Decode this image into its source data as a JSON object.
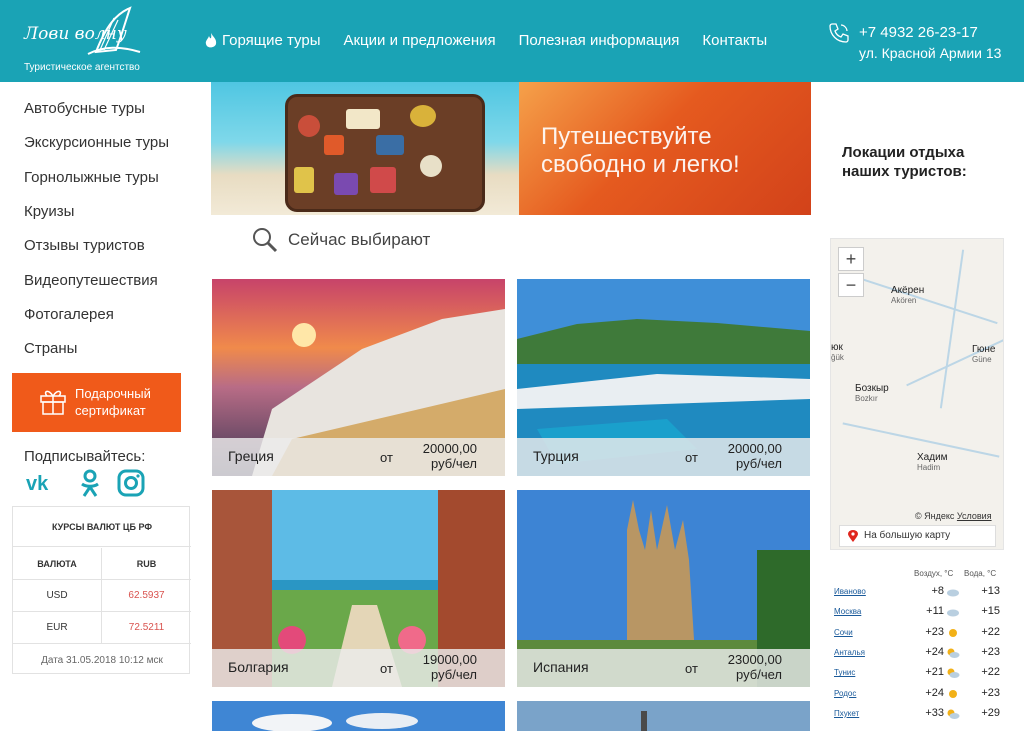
{
  "header": {
    "logo_script": "Лови волну",
    "logo_subtitle": "Туристическое агентство",
    "nav": [
      {
        "label": "Горящие туры",
        "icon": "fire-icon"
      },
      {
        "label": "Акции и предложения"
      },
      {
        "label": "Полезная информация"
      },
      {
        "label": "Контакты"
      }
    ],
    "phone": "+7 4932 26-23-17",
    "address": "ул. Красной Армии 13"
  },
  "sidebar": {
    "items": [
      {
        "label": "Автобусные туры"
      },
      {
        "label": "Экскурсионные туры"
      },
      {
        "label": "Горнолыжные туры"
      },
      {
        "label": "Круизы"
      },
      {
        "label": "Отзывы туристов"
      },
      {
        "label": "Видеопутешествия"
      },
      {
        "label": "Фотогалерея"
      },
      {
        "label": "Страны"
      }
    ],
    "gift": {
      "line1": "Подарочный",
      "line2": "сертификат",
      "icon": "gift-icon"
    },
    "subscribe_label": "Подписывайтесь:",
    "social": [
      "vk-icon",
      "odnoklassniki-icon",
      "instagram-icon"
    ]
  },
  "rates": {
    "title": "КУРСЫ ВАЛЮТ ЦБ РФ",
    "col_currency": "ВАЛЮТА",
    "col_rub": "RUB",
    "rows": [
      {
        "currency": "USD",
        "value": "62.5937"
      },
      {
        "currency": "EUR",
        "value": "72.5211"
      }
    ],
    "date": "Дата 31.05.2018 10:12 мск"
  },
  "banner": {
    "line1": "Путешествуйте",
    "line2": "свободно и легко!"
  },
  "choosing": {
    "label": "Сейчас выбирают",
    "icon": "magnifier-icon"
  },
  "cards": [
    {
      "name": "Греция",
      "from": "от",
      "price": "20000,00",
      "unit": "руб/чел"
    },
    {
      "name": "Турция",
      "from": "от",
      "price": "20000,00",
      "unit": "руб/чел"
    },
    {
      "name": "Болгария",
      "from": "от",
      "price": "19000,00",
      "unit": "руб/чел"
    },
    {
      "name": "Испания",
      "from": "от",
      "price": "23000,00",
      "unit": "руб/чел"
    }
  ],
  "locations": {
    "title_line1": "Локации отдыха",
    "title_line2": "наших туристов:",
    "map": {
      "zoom_in": "+",
      "zoom_out": "−",
      "labels": [
        {
          "name": "Акёрен",
          "tr": "Akören"
        },
        {
          "name": "юк",
          "tr": "ğük"
        },
        {
          "name": "Гюне",
          "tr": "Güne"
        },
        {
          "name": "Бозкыр",
          "tr": "Bozkır"
        },
        {
          "name": "Хадим",
          "tr": "Hadim"
        }
      ],
      "copyright": "© Яндекс",
      "terms": "Условия",
      "big_map": "На большую карту"
    }
  },
  "weather": {
    "air_head": "Воздух, °С",
    "water_head": "Вода, °С",
    "rows": [
      {
        "city": "Иваново",
        "air": "+8",
        "icon": "cloud-icon",
        "water": "+13"
      },
      {
        "city": "Москва",
        "air": "+11",
        "icon": "cloud-icon",
        "water": "+15"
      },
      {
        "city": "Сочи",
        "air": "+23",
        "icon": "sun-icon",
        "water": "+22"
      },
      {
        "city": "Анталья",
        "air": "+24",
        "icon": "sun-cloud-icon",
        "water": "+23"
      },
      {
        "city": "Тунис",
        "air": "+21",
        "icon": "sun-cloud-icon",
        "water": "+22"
      },
      {
        "city": "Родос",
        "air": "+24",
        "icon": "sun-icon",
        "water": "+23"
      },
      {
        "city": "Пхукет",
        "air": "+33",
        "icon": "sun-cloud-icon",
        "water": "+29"
      }
    ]
  },
  "colors": {
    "header_bg": "#1aa3b5",
    "accent_orange": "#f05a1a",
    "rate_red": "#d9534f"
  }
}
